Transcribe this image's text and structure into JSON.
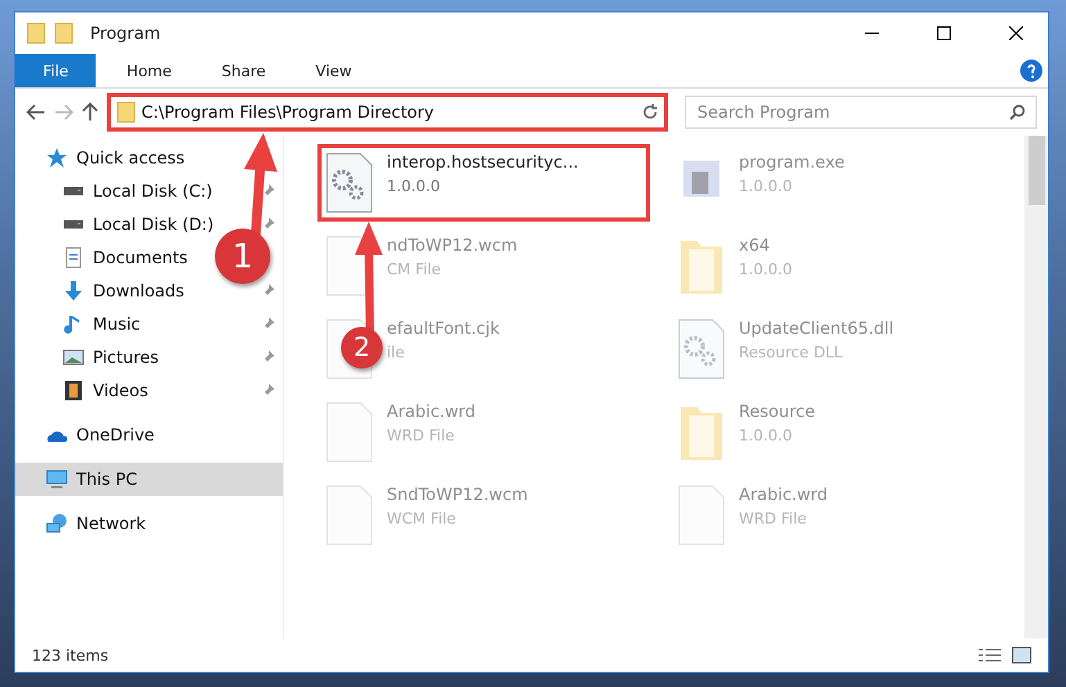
{
  "window": {
    "title": "Program"
  },
  "ribbon_tabs": [
    {
      "label": "File",
      "selected": true
    },
    {
      "label": "Home",
      "selected": false
    },
    {
      "label": "Share",
      "selected": false
    },
    {
      "label": "View",
      "selected": false
    }
  ],
  "address_bar": {
    "path": "C:\\Program Files\\Program Directory",
    "highlighted": true
  },
  "search": {
    "placeholder": "Search Program"
  },
  "sidebar": {
    "items": [
      {
        "label": "Quick access",
        "selected": false,
        "children": [
          {
            "label": "Local Disk (C:)",
            "pinned": true,
            "selected": false
          },
          {
            "label": "Local Disk (D:)",
            "pinned": true,
            "selected": false
          },
          {
            "label": "Documents",
            "pinned": false,
            "selected": false
          },
          {
            "label": "Downloads",
            "pinned": true,
            "selected": false
          },
          {
            "label": "Music",
            "pinned": true,
            "selected": false
          },
          {
            "label": "Pictures",
            "pinned": true,
            "selected": false
          },
          {
            "label": "Videos",
            "pinned": true,
            "selected": false
          }
        ]
      },
      {
        "label": "OneDrive",
        "selected": false
      },
      {
        "label": "This PC",
        "selected": true
      },
      {
        "label": "Network",
        "selected": false
      }
    ]
  },
  "files": [
    {
      "name": "interop.hostsecurityc...",
      "detail": "1.0.0.0",
      "kind": "dll",
      "highlighted": true
    },
    {
      "name": "program.exe",
      "detail": "1.0.0.0",
      "kind": "exe",
      "highlighted": false
    },
    {
      "name": "ndToWP12.wcm",
      "detail": "CM File",
      "kind": "file",
      "highlighted": false
    },
    {
      "name": "x64",
      "detail": "1.0.0.0",
      "kind": "folder",
      "highlighted": false
    },
    {
      "name": "efaultFont.cjk",
      "detail": "ile",
      "kind": "file",
      "highlighted": false
    },
    {
      "name": "UpdateClient65.dll",
      "detail": "Resource DLL",
      "kind": "dll",
      "highlighted": false
    },
    {
      "name": "Arabic.wrd",
      "detail": "WRD File",
      "kind": "file",
      "highlighted": false
    },
    {
      "name": "Resource",
      "detail": "1.0.0.0",
      "kind": "folder",
      "highlighted": false
    },
    {
      "name": "SndToWP12.wcm",
      "detail": "WCM File",
      "kind": "file",
      "highlighted": false
    },
    {
      "name": "Arabic.wrd",
      "detail": "WRD File",
      "kind": "file",
      "highlighted": false
    }
  ],
  "annotations": [
    {
      "number": "1"
    },
    {
      "number": "2"
    }
  ],
  "status_bar": {
    "count": "123 items"
  }
}
